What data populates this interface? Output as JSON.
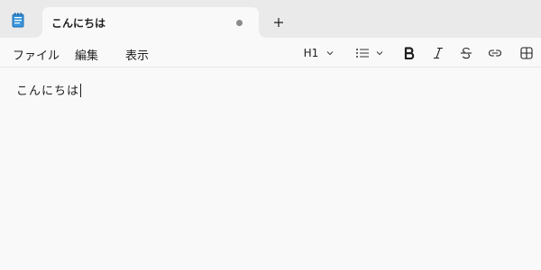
{
  "app": {
    "icon": "notepad-icon",
    "accent": "#2b88d8"
  },
  "tab": {
    "title": "こんにちは",
    "unsaved": true
  },
  "menu": {
    "file": "ファイル",
    "edit": "編集",
    "view": "表示"
  },
  "format": {
    "heading": "H1",
    "list_icon": "bulleted-list-icon",
    "bold_icon": "bold-icon",
    "italic_icon": "italic-icon",
    "strikethrough_icon": "strikethrough-icon",
    "link_icon": "link-icon",
    "table_icon": "table-icon"
  },
  "editor": {
    "content": "こんにちは"
  }
}
